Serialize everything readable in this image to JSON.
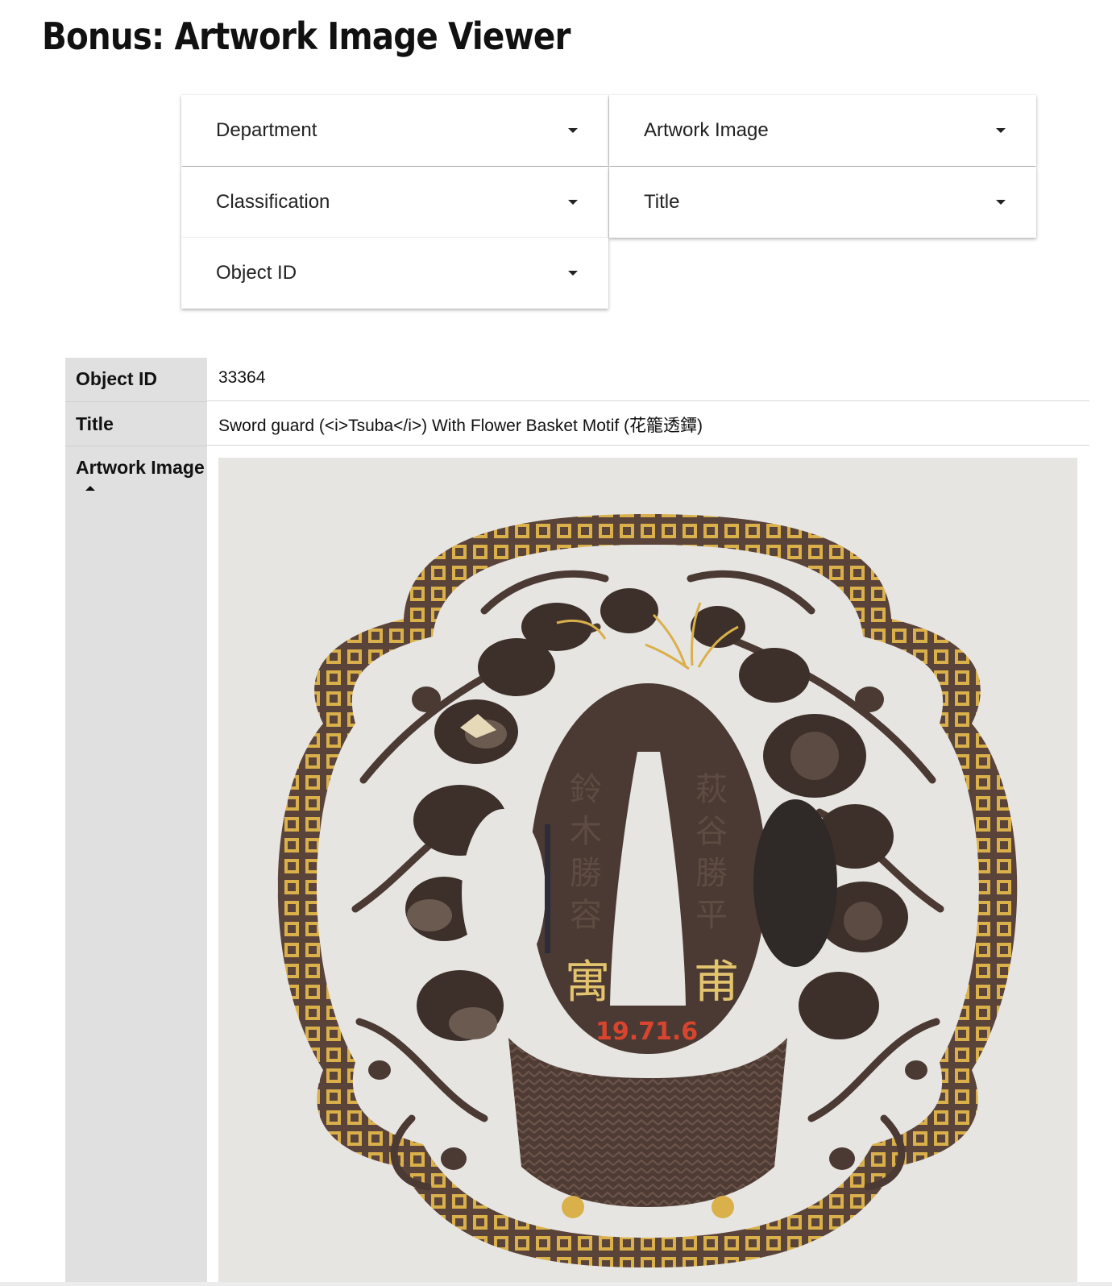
{
  "page": {
    "title": "Bonus: Artwork Image Viewer"
  },
  "filters": {
    "department": "Department",
    "artwork_image": "Artwork Image",
    "classification": "Classification",
    "title": "Title",
    "object_id": "Object ID"
  },
  "details": {
    "object_id_label": "Object ID",
    "object_id_value": "33364",
    "title_label": "Title",
    "title_value": "Sword guard (<i>Tsuba</i>) With Flower Basket Motif (花籠透鐔)",
    "image_label": "Artwork Image",
    "image_sort": "ascending"
  },
  "artwork": {
    "inscription_left": "鈴木勝容",
    "inscription_right": "萩谷勝平",
    "catalog_number": "19.71.6",
    "colors": {
      "background": "#e7e5e2",
      "iron": "#4a3a33",
      "gold": "#d9b04a",
      "catalog_red": "#d8442e"
    }
  }
}
